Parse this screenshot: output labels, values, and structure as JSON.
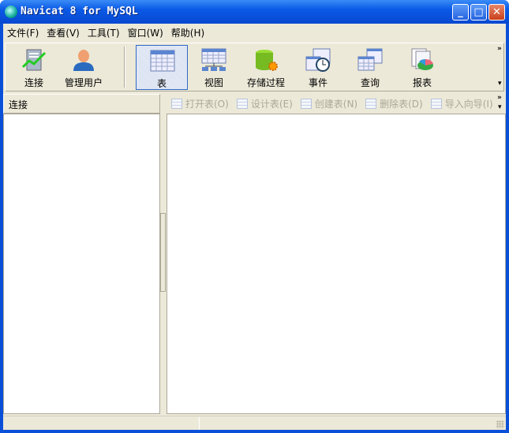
{
  "window": {
    "title": "Navicat 8 for MySQL",
    "minimize": "_",
    "maximize": "□",
    "close": "✕"
  },
  "menu": [
    "文件(F)",
    "查看(V)",
    "工具(T)",
    "窗口(W)",
    "帮助(H)"
  ],
  "toolbar": [
    {
      "label": "连接",
      "icon": "connection-icon"
    },
    {
      "label": "管理用户",
      "icon": "user-icon"
    },
    {
      "label": "表",
      "icon": "table-icon",
      "selected": true
    },
    {
      "label": "视图",
      "icon": "view-icon"
    },
    {
      "label": "存储过程",
      "icon": "procedure-icon"
    },
    {
      "label": "事件",
      "icon": "event-icon"
    },
    {
      "label": "查询",
      "icon": "query-icon"
    },
    {
      "label": "报表",
      "icon": "report-icon"
    }
  ],
  "more": "»",
  "dropdown": "▾",
  "left_panel": {
    "header": "连接"
  },
  "object_toolbar": [
    "打开表(O)",
    "设计表(E)",
    "创建表(N)",
    "删除表(D)",
    "导入向导(I)"
  ]
}
